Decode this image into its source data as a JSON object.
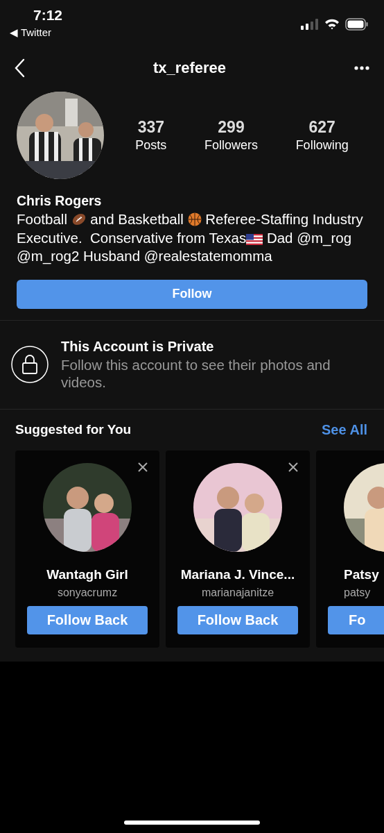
{
  "status_bar": {
    "time": "7:12",
    "back_app": "◀ Twitter"
  },
  "header": {
    "title": "tx_referee"
  },
  "profile": {
    "stats": [
      {
        "value": "337",
        "label": "Posts"
      },
      {
        "value": "299",
        "label": "Followers"
      },
      {
        "value": "627",
        "label": "Following"
      }
    ],
    "name": "Chris Rogers",
    "bio": [
      {
        "kind": "text",
        "text": "Football "
      },
      {
        "kind": "football"
      },
      {
        "kind": "text",
        "text": " and Basketball "
      },
      {
        "kind": "basketball"
      },
      {
        "kind": "text",
        "text": " Referee-Staffing Industry Executive.  Conservative from Texas"
      },
      {
        "kind": "flag"
      },
      {
        "kind": "text",
        "text": " Dad @m_rog @m_rog2 Husband @realestatemomma"
      }
    ],
    "follow_button": "Follow"
  },
  "private_notice": {
    "title": "This Account is Private",
    "text": "Follow this account to see their photos and videos."
  },
  "suggestions": {
    "title": "Suggested for You",
    "see_all": "See All",
    "cards": [
      {
        "name": "Wantagh Girl",
        "username": "sonyacrumz",
        "button": "Follow Back"
      },
      {
        "name": "Mariana J. Vince...",
        "username": "marianajanitze",
        "button": "Follow Back"
      },
      {
        "name": "Patsy",
        "username": "patsy",
        "button": "Fo"
      }
    ]
  }
}
